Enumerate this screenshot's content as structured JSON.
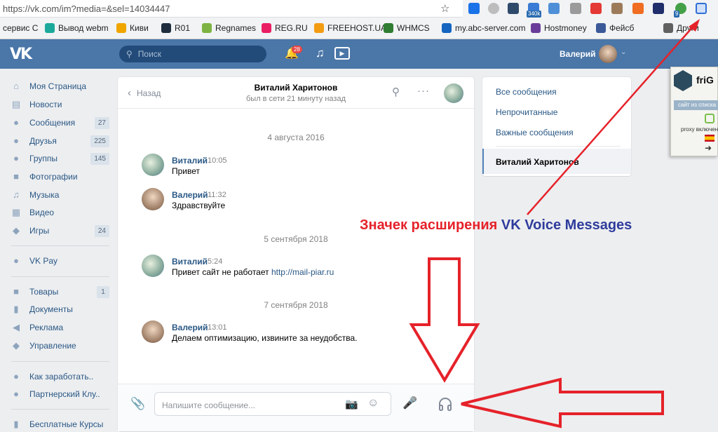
{
  "browser": {
    "url": "https://vk.com/im?media=&sel=14034447",
    "extensions": [
      {
        "name": "vpn-v-icon",
        "color": "#1a73e8",
        "badge": ""
      },
      {
        "name": "circle-icon",
        "color": "#bdbdbd",
        "badge": ""
      },
      {
        "name": "p-icon",
        "color": "#2e4a6b",
        "badge": ""
      },
      {
        "name": "stats-icon",
        "color": "#3a7bd5",
        "badge": "340k"
      },
      {
        "name": "chart-icon",
        "color": "#4f8fd8",
        "badge": ""
      },
      {
        "name": "pen-icon",
        "color": "#9a9a9a",
        "badge": ""
      },
      {
        "name": "yt-icon",
        "color": "#e53935",
        "badge": ""
      },
      {
        "name": "printer-icon",
        "color": "#9c7b5b",
        "badge": ""
      },
      {
        "name": "t-icon",
        "color": "#f06d22",
        "badge": ""
      },
      {
        "name": "ball-icon",
        "color": "#1f2d6b",
        "badge": ""
      },
      {
        "name": "g-icon",
        "color": "#43a047",
        "badge": "9"
      },
      {
        "name": "vk-voice-icon",
        "color": "#2f6fd6",
        "badge": ""
      }
    ]
  },
  "bookmarks": [
    {
      "label": "сервис С",
      "color": "#9e9e9e"
    },
    {
      "label": "Вывод webm",
      "color": "#1ca99b"
    },
    {
      "label": "Киви",
      "color": "#f0a500"
    },
    {
      "label": "R01",
      "color": "#1f2d3d"
    },
    {
      "label": "Regnames",
      "color": "#7cb342"
    },
    {
      "label": "REG.RU",
      "color": "#e91e63"
    },
    {
      "label": "FREEHOST.UA",
      "color": "#f39c12"
    },
    {
      "label": "WHMCS",
      "color": "#2e7d32"
    },
    {
      "label": "my.abc-server.com",
      "color": "#1565c0"
    },
    {
      "label": "Hostmoney",
      "color": "#6a3d9a"
    },
    {
      "label": "Фейсб",
      "color": "#3b5998"
    },
    {
      "label": "Други",
      "color": "#616161"
    }
  ],
  "header": {
    "logo": "VK",
    "search_placeholder": "Поиск",
    "notifications_count": "28",
    "user_name": "Валерий"
  },
  "sidebar": {
    "items": [
      {
        "label": "Моя Страница",
        "icon": "home-icon",
        "count": ""
      },
      {
        "label": "Новости",
        "icon": "news-icon",
        "count": ""
      },
      {
        "label": "Сообщения",
        "icon": "chat-icon",
        "count": "27"
      },
      {
        "label": "Друзья",
        "icon": "friend-icon",
        "count": "225"
      },
      {
        "label": "Группы",
        "icon": "groups-icon",
        "count": "145"
      },
      {
        "label": "Фотографии",
        "icon": "camera-icon",
        "count": ""
      },
      {
        "label": "Музыка",
        "icon": "music-icon",
        "count": ""
      },
      {
        "label": "Видео",
        "icon": "video-icon",
        "count": ""
      },
      {
        "label": "Игры",
        "icon": "gamepad-icon",
        "count": "24"
      },
      {
        "label": "VK Pay",
        "icon": "pay-icon",
        "count": ""
      },
      {
        "label": "Товары",
        "icon": "bag-icon",
        "count": "1"
      },
      {
        "label": "Документы",
        "icon": "doc-icon",
        "count": ""
      },
      {
        "label": "Реклама",
        "icon": "ads-icon",
        "count": ""
      },
      {
        "label": "Управление",
        "icon": "gamepad-icon",
        "count": ""
      },
      {
        "label": "Как заработать..",
        "icon": "friend-icon",
        "count": ""
      },
      {
        "label": "Партнерский Клу..",
        "icon": "friend-icon",
        "count": ""
      },
      {
        "label": "Бесплатные Курсы",
        "icon": "book-icon",
        "count": ""
      }
    ]
  },
  "chat": {
    "back_label": "Назад",
    "contact_name": "Виталий Харитонов",
    "status": "был в сети 21 минуту назад",
    "messages": [
      {
        "date": "4 августа 2016",
        "author": "Виталий",
        "time": "10:05",
        "text": "Привет",
        "link": "",
        "avatar": "v"
      },
      {
        "date": "",
        "author": "Валерий",
        "time": "11:32",
        "text": "Здравствуйте",
        "link": "",
        "avatar": "l"
      },
      {
        "date": "5 сентября 2018",
        "author": "Виталий",
        "time": "5:24",
        "text": "Привет сайт не работает ",
        "link": "http://mail-piar.ru",
        "avatar": "v"
      },
      {
        "date": "7 сентября 2018",
        "author": "Валерий",
        "time": "13:01",
        "text": "Делаем оптимизацию, извините за неудобства.",
        "link": "",
        "avatar": "l"
      }
    ],
    "input_placeholder": "Напишите сообщение..."
  },
  "right_menu": {
    "items": [
      "Все сообщения",
      "Непрочитанные",
      "Важные сообщения"
    ],
    "selected": "Виталий Харитонов"
  },
  "frigate": {
    "name": "friG",
    "site_text": "сайт из списка",
    "proxy_text": "proxy включен"
  },
  "annotation": {
    "text_red": "Значек расширения ",
    "text_blue": "VK Voice Messages",
    "color_red": "#e5222a",
    "color_blue": "#2e3c9c"
  }
}
